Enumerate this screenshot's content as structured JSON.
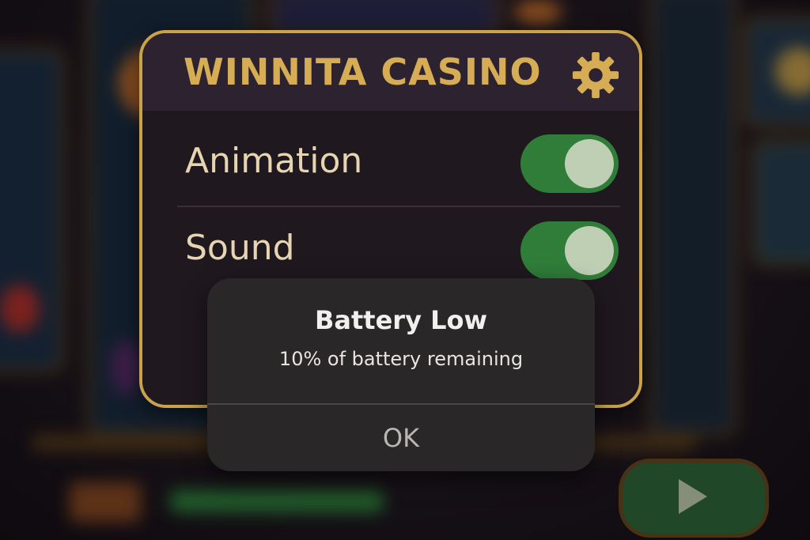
{
  "panel": {
    "title": "WINNITA CASINO",
    "settings_icon": "gear-icon",
    "settings": [
      {
        "label": "Animation",
        "enabled": true
      },
      {
        "label": "Sound",
        "enabled": true
      }
    ]
  },
  "alert": {
    "title": "Battery Low",
    "message": "10% of battery remaining",
    "ok_label": "OK"
  },
  "colors": {
    "accent_gold": "#c9a24a",
    "toggle_on": "#2f7d39",
    "panel_bg": "#231a24",
    "alert_bg": "#2a2728"
  },
  "background": {
    "description_icon": "slot-machine-background",
    "play_icon": "play-icon"
  }
}
